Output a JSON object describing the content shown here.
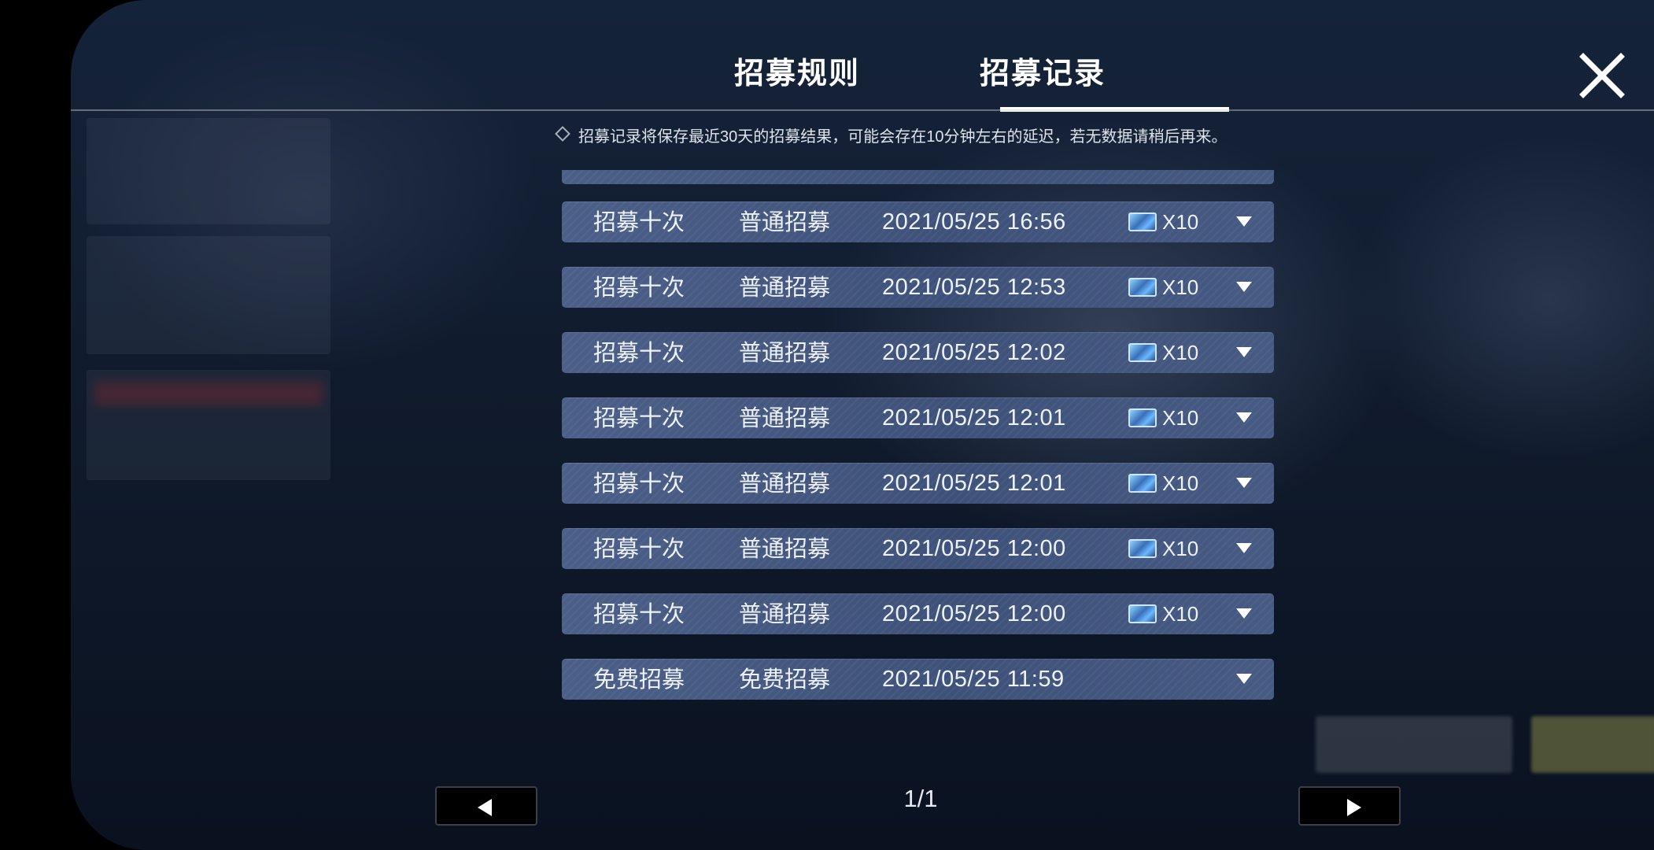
{
  "tabs": [
    {
      "label": "招募规则",
      "active": false
    },
    {
      "label": "招募记录",
      "active": true
    }
  ],
  "notice": {
    "icon": "diamond-outline-icon",
    "text": "招募记录将保存最近30天的招募结果，可能会存在10分钟左右的延迟，若无数据请稍后再来。"
  },
  "records": [
    {
      "type": "招募十次",
      "pool": "普通招募",
      "time": "2021/05/25 16:56",
      "ticket_icon": "recruit-ticket-icon",
      "count": "X10"
    },
    {
      "type": "招募十次",
      "pool": "普通招募",
      "time": "2021/05/25 12:53",
      "ticket_icon": "recruit-ticket-icon",
      "count": "X10"
    },
    {
      "type": "招募十次",
      "pool": "普通招募",
      "time": "2021/05/25 12:02",
      "ticket_icon": "recruit-ticket-icon",
      "count": "X10"
    },
    {
      "type": "招募十次",
      "pool": "普通招募",
      "time": "2021/05/25 12:01",
      "ticket_icon": "recruit-ticket-icon",
      "count": "X10"
    },
    {
      "type": "招募十次",
      "pool": "普通招募",
      "time": "2021/05/25 12:01",
      "ticket_icon": "recruit-ticket-icon",
      "count": "X10"
    },
    {
      "type": "招募十次",
      "pool": "普通招募",
      "time": "2021/05/25 12:00",
      "ticket_icon": "recruit-ticket-icon",
      "count": "X10"
    },
    {
      "type": "招募十次",
      "pool": "普通招募",
      "time": "2021/05/25 12:00",
      "ticket_icon": "recruit-ticket-icon",
      "count": "X10"
    },
    {
      "type": "免费招募",
      "pool": "免费招募",
      "time": "2021/05/25 11:59",
      "ticket_icon": "",
      "count": ""
    }
  ],
  "pagination": {
    "label": "1/1"
  },
  "icons": {
    "close": "close-x-icon",
    "prev": "triangle-left-icon",
    "next": "triangle-right-icon",
    "expand": "triangle-down-icon"
  },
  "colors": {
    "row": "#455983",
    "accent": "#ffffff",
    "header_line": "#c8cdc8"
  }
}
